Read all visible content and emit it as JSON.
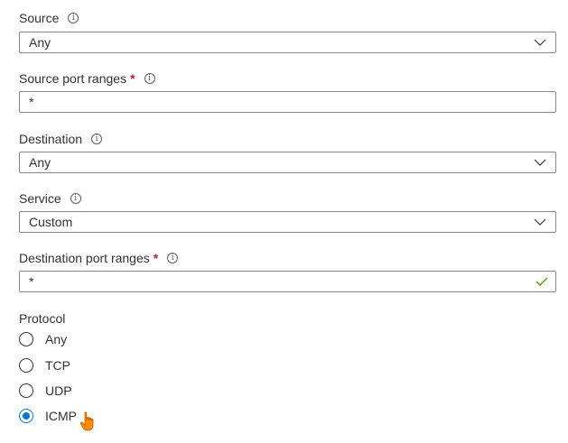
{
  "fields": {
    "source": {
      "label": "Source",
      "value": "Any"
    },
    "source_port_ranges": {
      "label": "Source port ranges",
      "required_mark": "*",
      "value": "*"
    },
    "destination": {
      "label": "Destination",
      "value": "Any"
    },
    "service": {
      "label": "Service",
      "value": "Custom"
    },
    "destination_port_ranges": {
      "label": "Destination port ranges",
      "required_mark": "*",
      "value": "*"
    },
    "protocol": {
      "label": "Protocol",
      "options": [
        "Any",
        "TCP",
        "UDP",
        "ICMP"
      ],
      "selected": "ICMP"
    }
  },
  "colors": {
    "accent": "#0078d4",
    "required": "#a4262c",
    "valid_check": "#57a300",
    "cursor": "#ff8c00"
  },
  "icons": {
    "info": "info-icon",
    "dropdown": "chevron-down-icon",
    "valid": "checkmark-icon",
    "pointer": "hand-pointer-icon"
  }
}
